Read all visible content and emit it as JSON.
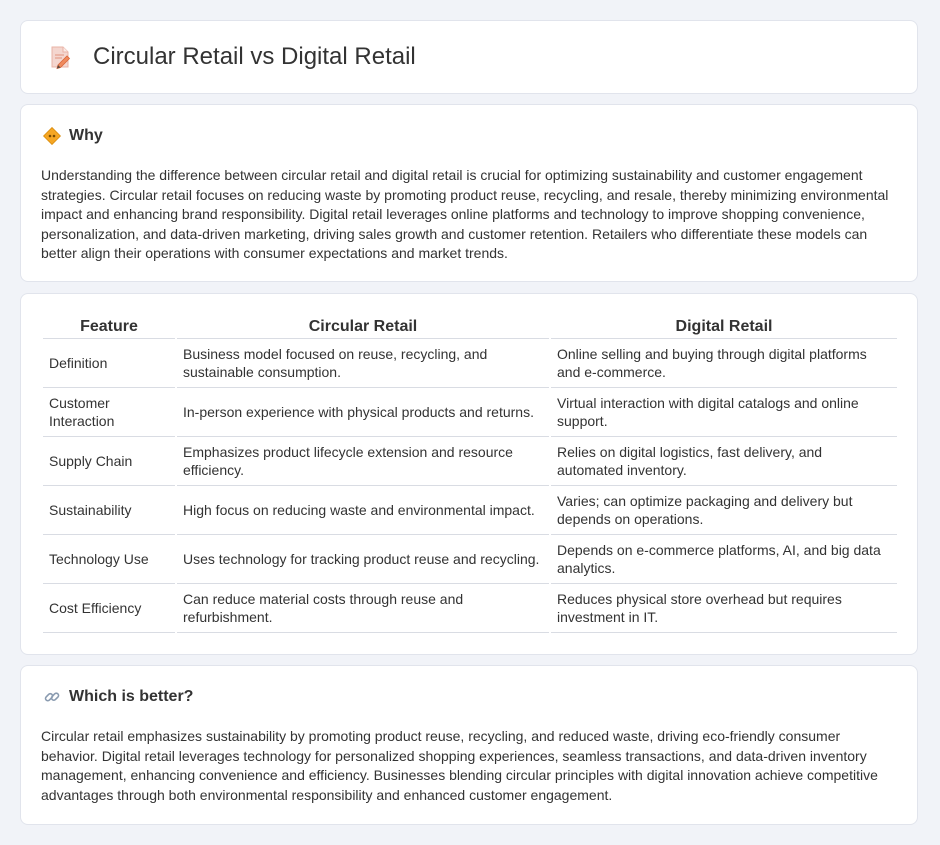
{
  "header": {
    "title": "Circular Retail vs Digital Retail",
    "icon": "document-pencil-icon"
  },
  "why": {
    "heading": "Why",
    "icon": "diamond-sign-icon",
    "text": "Understanding the difference between circular retail and digital retail is crucial for optimizing sustainability and customer engagement strategies. Circular retail focuses on reducing waste by promoting product reuse, recycling, and resale, thereby minimizing environmental impact and enhancing brand responsibility. Digital retail leverages online platforms and technology to improve shopping convenience, personalization, and data-driven marketing, driving sales growth and customer retention. Retailers who differentiate these models can better align their operations with consumer expectations and market trends."
  },
  "table": {
    "headers": [
      "Feature",
      "Circular Retail",
      "Digital Retail"
    ],
    "rows": [
      {
        "feature": "Definition",
        "circular": "Business model focused on reuse, recycling, and sustainable consumption.",
        "digital": "Online selling and buying through digital platforms and e-commerce."
      },
      {
        "feature": "Customer Interaction",
        "circular": "In-person experience with physical products and returns.",
        "digital": "Virtual interaction with digital catalogs and online support."
      },
      {
        "feature": "Supply Chain",
        "circular": "Emphasizes product lifecycle extension and resource efficiency.",
        "digital": "Relies on digital logistics, fast delivery, and automated inventory."
      },
      {
        "feature": "Sustainability",
        "circular": "High focus on reducing waste and environmental impact.",
        "digital": "Varies; can optimize packaging and delivery but depends on operations."
      },
      {
        "feature": "Technology Use",
        "circular": "Uses technology for tracking product reuse and recycling.",
        "digital": "Depends on e-commerce platforms, AI, and big data analytics."
      },
      {
        "feature": "Cost Efficiency",
        "circular": "Can reduce material costs through reuse and refurbishment.",
        "digital": "Reduces physical store overhead but requires investment in IT."
      }
    ]
  },
  "better": {
    "heading": "Which is better?",
    "icon": "link-icon",
    "text": "Circular retail emphasizes sustainability by promoting product reuse, recycling, and reduced waste, driving eco-friendly consumer behavior. Digital retail leverages technology for personalized shopping experiences, seamless transactions, and data-driven inventory management, enhancing convenience and efficiency. Businesses blending circular principles with digital innovation achieve competitive advantages through both environmental responsibility and enhanced customer engagement."
  }
}
